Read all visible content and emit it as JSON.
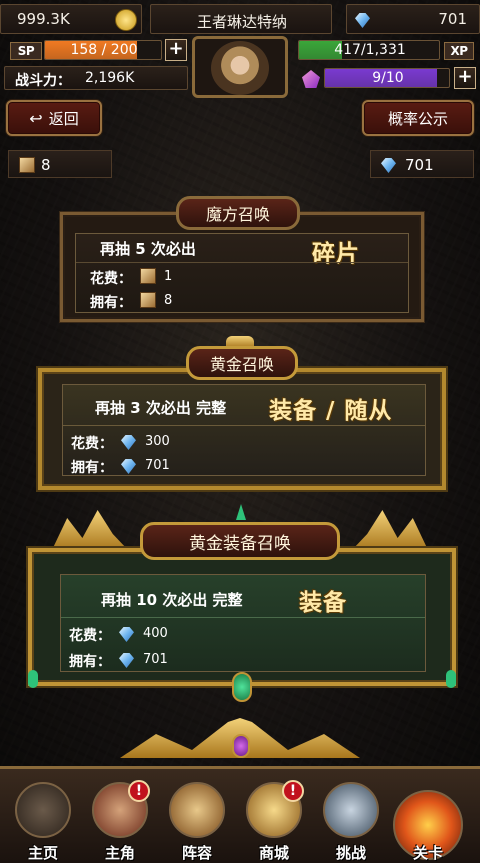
{
  "hud": {
    "gold": "999.3K",
    "player_name": "王者琳达特纳",
    "diamonds": "701",
    "sp_label": "SP",
    "sp": "158 / 200",
    "sp_fraction": 0.79,
    "xp": "417/1,331",
    "xp_label": "XP",
    "xp_fraction": 0.31,
    "power_label": "战斗力：",
    "power": "2,196K",
    "stamina": "9/10",
    "stamina_fraction": 0.9
  },
  "buttons": {
    "back": "返回",
    "odds": "概率公示"
  },
  "resources": {
    "cubes": "8",
    "diamonds": "701"
  },
  "summons": [
    {
      "title": "魔方召唤",
      "draw_text": "再抽  5  次必出",
      "reward": "碎片",
      "cost_label": "花费：",
      "cost": "1",
      "own_label": "拥有：",
      "own": "8"
    },
    {
      "title": "黄金召唤",
      "draw_text": "再抽  3  次必出 完整",
      "reward": "装备 / 随从",
      "cost_label": "花费：",
      "cost": "300",
      "own_label": "拥有：",
      "own": "701"
    },
    {
      "title": "黄金装备召唤",
      "draw_text": "再抽 10 次必出 完整",
      "reward": "装备",
      "cost_label": "花费：",
      "cost": "400",
      "own_label": "拥有：",
      "own": "701"
    }
  ],
  "nav": [
    {
      "label": "主页",
      "icon": "home-icon",
      "badge": ""
    },
    {
      "label": "主角",
      "icon": "hero-icon",
      "badge": "!"
    },
    {
      "label": "阵容",
      "icon": "team-icon",
      "badge": ""
    },
    {
      "label": "商城",
      "icon": "shop-icon",
      "badge": "!"
    },
    {
      "label": "挑战",
      "icon": "challenge-icon",
      "badge": ""
    },
    {
      "label": "关卡",
      "icon": "stage-icon",
      "badge": ""
    }
  ],
  "colors": {
    "sp_bar": "#f07a22",
    "xp_bar": "#3aa63a",
    "stamina_bar": "#7a3ad0"
  }
}
